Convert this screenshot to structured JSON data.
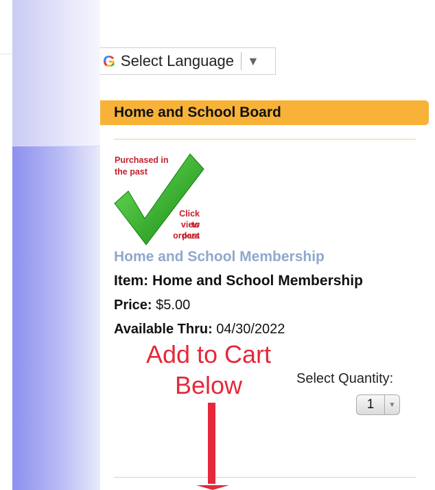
{
  "language_widget": {
    "g_icon": "G",
    "label": "Select Language",
    "caret": "▼",
    "icon": "google-g-icon"
  },
  "section": {
    "title": "Home and School Board"
  },
  "purchased_badge": {
    "line1": "Purchased in",
    "line2": "the past",
    "click_line1": "Click to",
    "click_line2": "view past",
    "click_line3": "orders",
    "icon": "checkmark-icon",
    "check_color": "#2fb12a"
  },
  "product": {
    "link_text": "Home and School Membership",
    "item_label": "Item:",
    "item_value": "Home and School Membership",
    "price_label": "Price:",
    "price_value": "$5.00",
    "avail_label": "Available Thru:",
    "avail_value": "04/30/2022"
  },
  "annotation": {
    "line1": "Add to Cart",
    "line2": "Below",
    "color": "#e5283a"
  },
  "quantity": {
    "label": "Select Quantity:",
    "value": "1"
  }
}
